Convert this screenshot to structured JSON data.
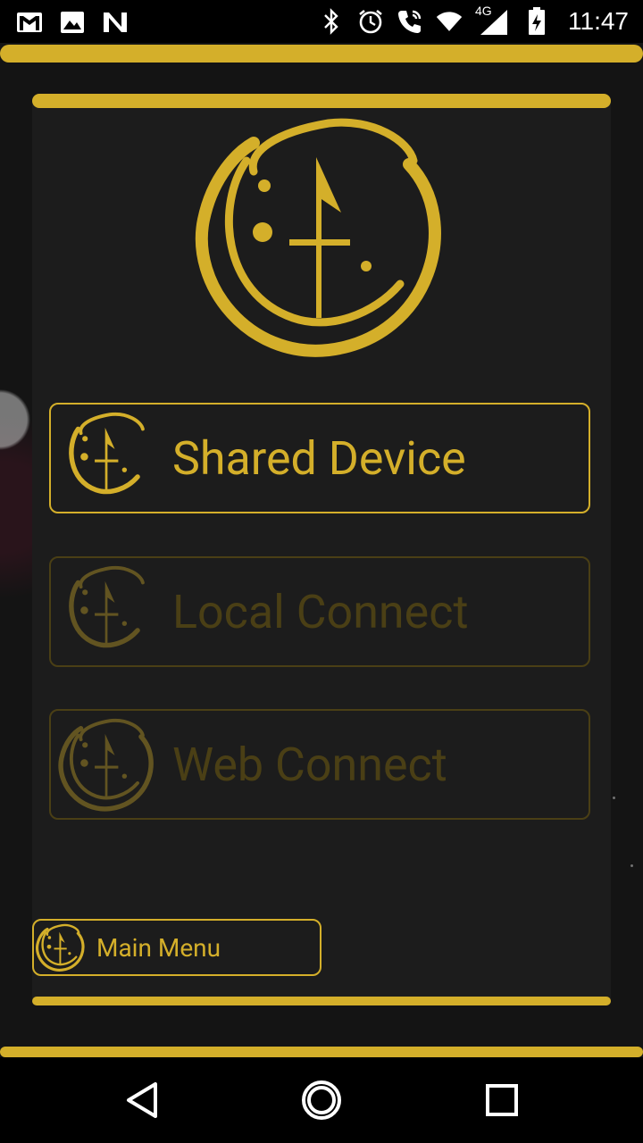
{
  "status_bar": {
    "left_icons": [
      "gmail-icon",
      "gallery-icon",
      "n-notification-icon"
    ],
    "right_icons": [
      "bluetooth-icon",
      "alarm-icon",
      "call-icon",
      "wifi-icon",
      "signal-icon",
      "battery-charging-icon"
    ],
    "network_type": "4G",
    "time": "11:47"
  },
  "colors": {
    "accent_gold": "#d4af2a",
    "disabled_gold": "#4a3f15",
    "background": "#141414",
    "panel": "#1c1c1c"
  },
  "logo": {
    "icon": "crescent-sword-logo-icon"
  },
  "menu": {
    "buttons": [
      {
        "label": "Shared Device",
        "enabled": true,
        "icon": "crescent-sword-logo-icon"
      },
      {
        "label": "Local Connect",
        "enabled": false,
        "icon": "crescent-sword-logo-icon"
      },
      {
        "label": "Web Connect",
        "enabled": false,
        "icon": "crescent-sword-logo-icon"
      }
    ],
    "main_menu_label": "Main Menu"
  },
  "nav_bar": {
    "buttons": [
      "back-icon",
      "home-icon",
      "recents-icon"
    ]
  }
}
